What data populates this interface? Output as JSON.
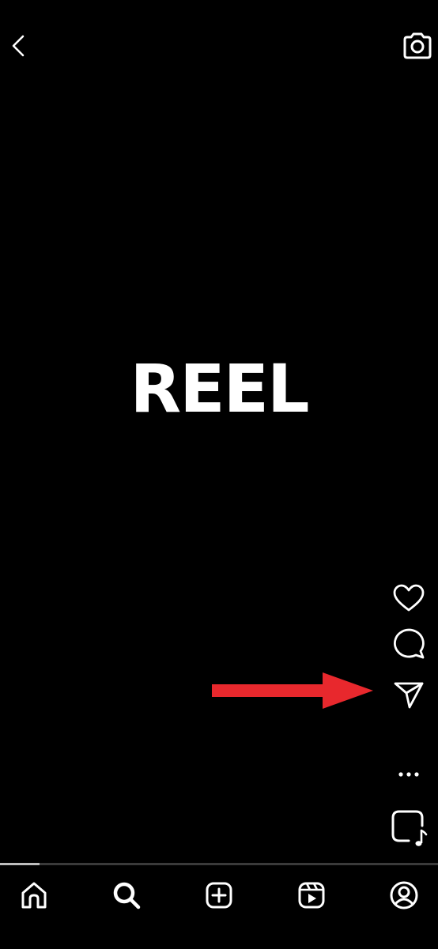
{
  "reel": {
    "overlay_text": "REEL"
  },
  "header": {
    "icons": [
      "back-arrow-icon",
      "camera-icon"
    ]
  },
  "actions": {
    "icons": [
      "heart-icon",
      "comment-icon",
      "send-icon",
      "more-dots-icon",
      "audio-sticker-icon"
    ]
  },
  "annotation": {
    "color": "#e8282d",
    "points_to": "send-icon"
  },
  "progress": {
    "fraction": 0.09
  },
  "bottom_nav": {
    "icons": [
      "home-icon",
      "search-icon",
      "create-icon",
      "reels-icon",
      "profile-icon"
    ],
    "active": "search-icon"
  }
}
